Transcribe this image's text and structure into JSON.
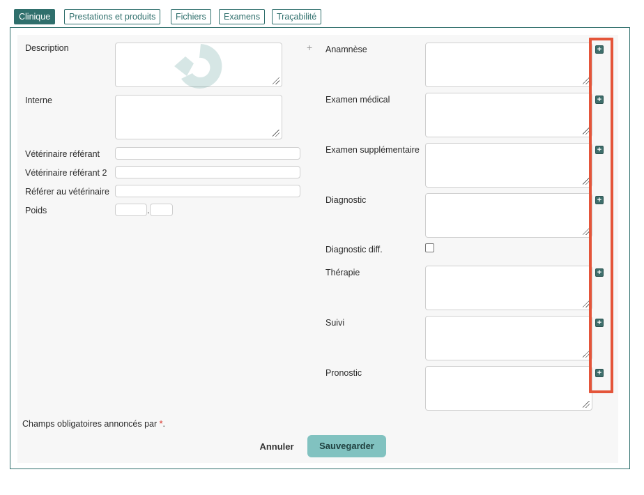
{
  "tabs": [
    {
      "label": "Clinique"
    },
    {
      "label": "Prestations et produits"
    },
    {
      "label": "Fichiers"
    },
    {
      "label": "Examens"
    },
    {
      "label": "Traçabilité"
    }
  ],
  "left": {
    "description_label": "Description",
    "interne_label": "Interne",
    "vet_ref_label": "Vétérinaire référant",
    "vet_ref2_label": "Vétérinaire référant 2",
    "referer_label": "Référer au vétérinaire",
    "poids_label": "Poids",
    "poids_separator": "."
  },
  "right": {
    "anamnese_label": "Anamnèse",
    "examen_medical_label": "Examen médical",
    "examen_supp_label": "Examen supplémentaire",
    "diagnostic_label": "Diagnostic",
    "diagnostic_diff_label": "Diagnostic diff.",
    "therapie_label": "Thérapie",
    "suivi_label": "Suivi",
    "pronostic_label": "Pronostic",
    "add_symbol": "+",
    "small_plus": "+"
  },
  "footer": {
    "required_note": "Champs obligatoires annoncés par ",
    "required_star": "*",
    "required_end": ".",
    "cancel_label": "Annuler",
    "save_label": "Sauvegarder"
  },
  "colors": {
    "accent": "#2f6f6c",
    "save_button": "#81c2c0",
    "highlight": "#e4553a"
  }
}
